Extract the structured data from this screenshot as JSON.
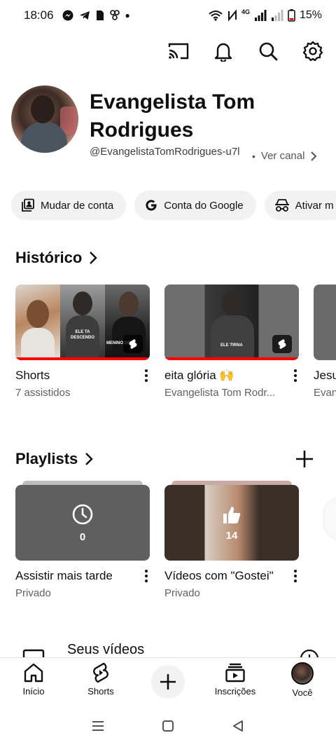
{
  "status_bar": {
    "time": "18:06",
    "network_label": "4G",
    "battery": "15%"
  },
  "top_actions": [
    "cast-icon",
    "bell-icon",
    "search-icon",
    "gear-icon"
  ],
  "profile": {
    "name": "Evangelista Tom Rodrigues",
    "handle": "@EvangelistaTomRodrigues-u7l",
    "view_channel": "Ver canal",
    "separator": "•"
  },
  "chips": [
    {
      "label": "Mudar de conta",
      "icon": "switch-account-icon"
    },
    {
      "label": "Conta do Google",
      "icon": "google-icon"
    },
    {
      "label": "Ativar m",
      "icon": "incognito-icon"
    }
  ],
  "history": {
    "title": "Histórico",
    "items": [
      {
        "title": "Shorts",
        "subtitle": "7 assistidos"
      },
      {
        "title": "eita glória 🙌",
        "subtitle": "Evangelista Tom Rodr..."
      },
      {
        "title": "Jesu",
        "subtitle": "Evan"
      }
    ],
    "overlay_texts": [
      "ELE TA DESCENDO",
      "MENINO DE",
      "ELE TIRNA"
    ]
  },
  "playlists": {
    "title": "Playlists",
    "items": [
      {
        "title": "Assistir mais tarde",
        "subtitle": "Privado",
        "count": "0"
      },
      {
        "title": "Vídeos com \"Gostei\"",
        "subtitle": "Privado",
        "count": "14"
      }
    ]
  },
  "your_videos": {
    "label": "Seus vídeos"
  },
  "bottom_nav": [
    {
      "label": "Início",
      "icon": "home-icon"
    },
    {
      "label": "Shorts",
      "icon": "shorts-icon"
    },
    {
      "label": "",
      "icon": "create-icon"
    },
    {
      "label": "Inscrições",
      "icon": "subscriptions-icon"
    },
    {
      "label": "Você",
      "icon": "avatar"
    }
  ]
}
